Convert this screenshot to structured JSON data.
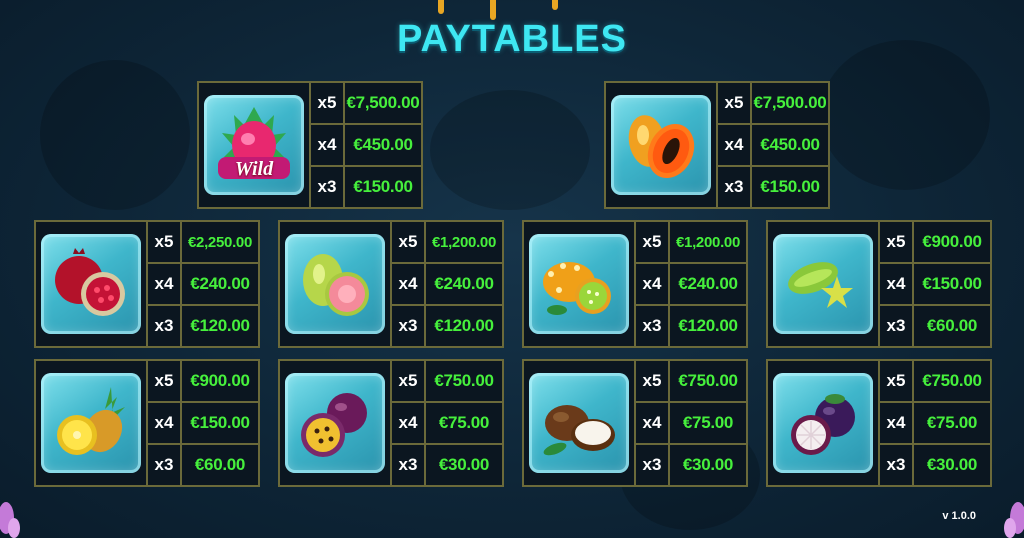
{
  "title": "PAYTABLES",
  "version": "v 1.0.0",
  "colors": {
    "title": "#3ee7f2",
    "pay": "#46f03c",
    "border": "#6b6a3a"
  },
  "symbols": [
    {
      "icon": "dragonfruit-wild-icon",
      "wild_label": "Wild",
      "pays": [
        {
          "mult": "x5",
          "value": "€7,500.00"
        },
        {
          "mult": "x4",
          "value": "€450.00"
        },
        {
          "mult": "x3",
          "value": "€150.00"
        }
      ]
    },
    {
      "icon": "papaya-icon",
      "pays": [
        {
          "mult": "x5",
          "value": "€7,500.00"
        },
        {
          "mult": "x4",
          "value": "€450.00"
        },
        {
          "mult": "x3",
          "value": "€150.00"
        }
      ]
    },
    {
      "icon": "pomegranate-icon",
      "pays": [
        {
          "mult": "x5",
          "value": "€2,250.00"
        },
        {
          "mult": "x4",
          "value": "€240.00"
        },
        {
          "mult": "x3",
          "value": "€120.00"
        }
      ]
    },
    {
      "icon": "guava-icon",
      "pays": [
        {
          "mult": "x5",
          "value": "€1,200.00"
        },
        {
          "mult": "x4",
          "value": "€240.00"
        },
        {
          "mult": "x3",
          "value": "€120.00"
        }
      ]
    },
    {
      "icon": "kiwano-icon",
      "pays": [
        {
          "mult": "x5",
          "value": "€1,200.00"
        },
        {
          "mult": "x4",
          "value": "€240.00"
        },
        {
          "mult": "x3",
          "value": "€120.00"
        }
      ]
    },
    {
      "icon": "starfruit-icon",
      "pays": [
        {
          "mult": "x5",
          "value": "€900.00"
        },
        {
          "mult": "x4",
          "value": "€150.00"
        },
        {
          "mult": "x3",
          "value": "€60.00"
        }
      ]
    },
    {
      "icon": "pineapple-icon",
      "pays": [
        {
          "mult": "x5",
          "value": "€900.00"
        },
        {
          "mult": "x4",
          "value": "€150.00"
        },
        {
          "mult": "x3",
          "value": "€60.00"
        }
      ]
    },
    {
      "icon": "passionfruit-icon",
      "pays": [
        {
          "mult": "x5",
          "value": "€750.00"
        },
        {
          "mult": "x4",
          "value": "€75.00"
        },
        {
          "mult": "x3",
          "value": "€30.00"
        }
      ]
    },
    {
      "icon": "coconut-icon",
      "pays": [
        {
          "mult": "x5",
          "value": "€750.00"
        },
        {
          "mult": "x4",
          "value": "€75.00"
        },
        {
          "mult": "x3",
          "value": "€30.00"
        }
      ]
    },
    {
      "icon": "mangosteen-icon",
      "pays": [
        {
          "mult": "x5",
          "value": "€750.00"
        },
        {
          "mult": "x4",
          "value": "€75.00"
        },
        {
          "mult": "x3",
          "value": "€30.00"
        }
      ]
    }
  ]
}
